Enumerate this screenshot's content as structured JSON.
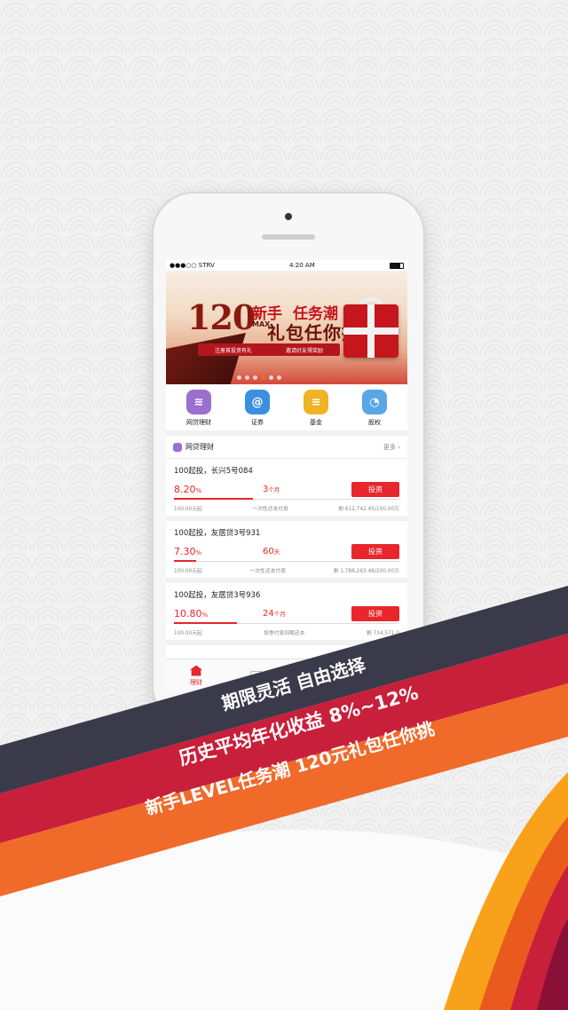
{
  "statusbar": {
    "carrier": "●●●○○ STRV",
    "time": "4:20 AM"
  },
  "banner": {
    "amount": "120",
    "max": "MAX",
    "new_user": "新手",
    "task": "任务潮",
    "gift": "礼包任你挑",
    "bar_left": "注册首投资有礼",
    "bar_right": "邀请好友得奖励",
    "dots_total": 6,
    "dots_active_index": 3
  },
  "quick_nav": [
    {
      "label": "网贷理财",
      "icon": "layers-icon",
      "color": "#9a6fcf"
    },
    {
      "label": "证券",
      "icon": "securities-icon",
      "color": "#3a8fe0"
    },
    {
      "label": "基金",
      "icon": "coins-icon",
      "color": "#f0b323"
    },
    {
      "label": "股权",
      "icon": "pie-chart-icon",
      "color": "#5aa7e8"
    }
  ],
  "section": {
    "title": "网贷理财",
    "more": "更多"
  },
  "products": [
    {
      "name": "100起投，长兴5号084",
      "rate": "8.20",
      "rate_unit": "%",
      "term": "3",
      "term_unit": "个月",
      "button": "投资",
      "min": "100.00元起",
      "repay": "一次性还本付息",
      "remain": "剩 612,742.45/100.00万",
      "progress": 0.35
    },
    {
      "name": "100起投，友居贷3号931",
      "rate": "7.30",
      "rate_unit": "%",
      "term": "60",
      "term_unit": "天",
      "button": "投资",
      "min": "100.00元起",
      "repay": "一次性还本付息",
      "remain": "剩 1,788,263.48/200.00万",
      "progress": 0.1
    },
    {
      "name": "100起投，友居贷3号936",
      "rate": "10.80",
      "rate_unit": "%",
      "term": "24",
      "term_unit": "个月",
      "button": "投资",
      "min": "100.00元起",
      "repay": "按季付息到期还本",
      "remain": "剩 734,571.0",
      "progress": 0.28
    }
  ],
  "tabbar": {
    "home": "理财"
  },
  "stripes": {
    "line1": "期限灵活  自由选择",
    "line2": "历史平均年化收益 8%~12%",
    "line3": "新手LEVEL任务潮   120元礼包任你挑"
  },
  "colors": {
    "dark": "#3a3a4a",
    "red": "#c81f3a",
    "orange": "#f06a2a",
    "accent": "#e8262b"
  }
}
